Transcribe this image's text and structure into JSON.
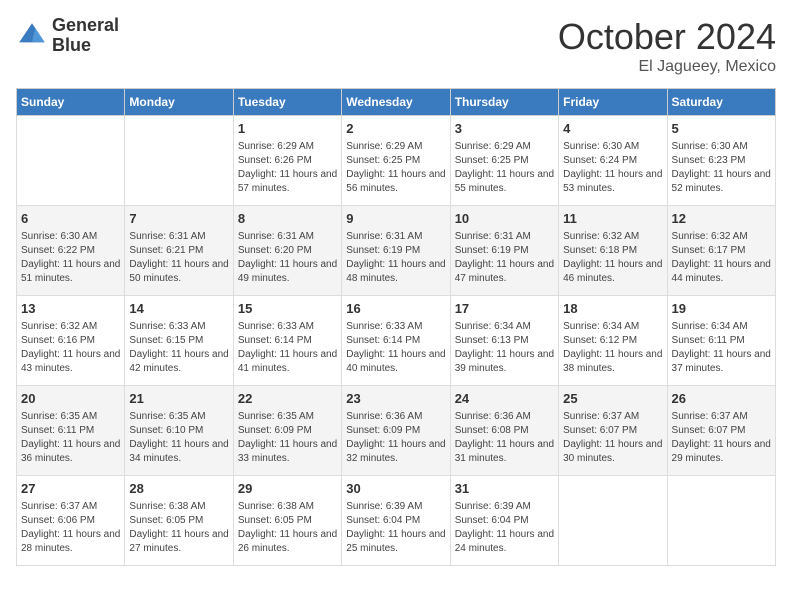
{
  "header": {
    "logo_line1": "General",
    "logo_line2": "Blue",
    "month": "October 2024",
    "location": "El Jagueey, Mexico"
  },
  "columns": [
    "Sunday",
    "Monday",
    "Tuesday",
    "Wednesday",
    "Thursday",
    "Friday",
    "Saturday"
  ],
  "weeks": [
    [
      {
        "day": "",
        "empty": true
      },
      {
        "day": "",
        "empty": true
      },
      {
        "day": "1",
        "sunrise": "Sunrise: 6:29 AM",
        "sunset": "Sunset: 6:26 PM",
        "daylight": "Daylight: 11 hours and 57 minutes."
      },
      {
        "day": "2",
        "sunrise": "Sunrise: 6:29 AM",
        "sunset": "Sunset: 6:25 PM",
        "daylight": "Daylight: 11 hours and 56 minutes."
      },
      {
        "day": "3",
        "sunrise": "Sunrise: 6:29 AM",
        "sunset": "Sunset: 6:25 PM",
        "daylight": "Daylight: 11 hours and 55 minutes."
      },
      {
        "day": "4",
        "sunrise": "Sunrise: 6:30 AM",
        "sunset": "Sunset: 6:24 PM",
        "daylight": "Daylight: 11 hours and 53 minutes."
      },
      {
        "day": "5",
        "sunrise": "Sunrise: 6:30 AM",
        "sunset": "Sunset: 6:23 PM",
        "daylight": "Daylight: 11 hours and 52 minutes."
      }
    ],
    [
      {
        "day": "6",
        "sunrise": "Sunrise: 6:30 AM",
        "sunset": "Sunset: 6:22 PM",
        "daylight": "Daylight: 11 hours and 51 minutes."
      },
      {
        "day": "7",
        "sunrise": "Sunrise: 6:31 AM",
        "sunset": "Sunset: 6:21 PM",
        "daylight": "Daylight: 11 hours and 50 minutes."
      },
      {
        "day": "8",
        "sunrise": "Sunrise: 6:31 AM",
        "sunset": "Sunset: 6:20 PM",
        "daylight": "Daylight: 11 hours and 49 minutes."
      },
      {
        "day": "9",
        "sunrise": "Sunrise: 6:31 AM",
        "sunset": "Sunset: 6:19 PM",
        "daylight": "Daylight: 11 hours and 48 minutes."
      },
      {
        "day": "10",
        "sunrise": "Sunrise: 6:31 AM",
        "sunset": "Sunset: 6:19 PM",
        "daylight": "Daylight: 11 hours and 47 minutes."
      },
      {
        "day": "11",
        "sunrise": "Sunrise: 6:32 AM",
        "sunset": "Sunset: 6:18 PM",
        "daylight": "Daylight: 11 hours and 46 minutes."
      },
      {
        "day": "12",
        "sunrise": "Sunrise: 6:32 AM",
        "sunset": "Sunset: 6:17 PM",
        "daylight": "Daylight: 11 hours and 44 minutes."
      }
    ],
    [
      {
        "day": "13",
        "sunrise": "Sunrise: 6:32 AM",
        "sunset": "Sunset: 6:16 PM",
        "daylight": "Daylight: 11 hours and 43 minutes."
      },
      {
        "day": "14",
        "sunrise": "Sunrise: 6:33 AM",
        "sunset": "Sunset: 6:15 PM",
        "daylight": "Daylight: 11 hours and 42 minutes."
      },
      {
        "day": "15",
        "sunrise": "Sunrise: 6:33 AM",
        "sunset": "Sunset: 6:14 PM",
        "daylight": "Daylight: 11 hours and 41 minutes."
      },
      {
        "day": "16",
        "sunrise": "Sunrise: 6:33 AM",
        "sunset": "Sunset: 6:14 PM",
        "daylight": "Daylight: 11 hours and 40 minutes."
      },
      {
        "day": "17",
        "sunrise": "Sunrise: 6:34 AM",
        "sunset": "Sunset: 6:13 PM",
        "daylight": "Daylight: 11 hours and 39 minutes."
      },
      {
        "day": "18",
        "sunrise": "Sunrise: 6:34 AM",
        "sunset": "Sunset: 6:12 PM",
        "daylight": "Daylight: 11 hours and 38 minutes."
      },
      {
        "day": "19",
        "sunrise": "Sunrise: 6:34 AM",
        "sunset": "Sunset: 6:11 PM",
        "daylight": "Daylight: 11 hours and 37 minutes."
      }
    ],
    [
      {
        "day": "20",
        "sunrise": "Sunrise: 6:35 AM",
        "sunset": "Sunset: 6:11 PM",
        "daylight": "Daylight: 11 hours and 36 minutes."
      },
      {
        "day": "21",
        "sunrise": "Sunrise: 6:35 AM",
        "sunset": "Sunset: 6:10 PM",
        "daylight": "Daylight: 11 hours and 34 minutes."
      },
      {
        "day": "22",
        "sunrise": "Sunrise: 6:35 AM",
        "sunset": "Sunset: 6:09 PM",
        "daylight": "Daylight: 11 hours and 33 minutes."
      },
      {
        "day": "23",
        "sunrise": "Sunrise: 6:36 AM",
        "sunset": "Sunset: 6:09 PM",
        "daylight": "Daylight: 11 hours and 32 minutes."
      },
      {
        "day": "24",
        "sunrise": "Sunrise: 6:36 AM",
        "sunset": "Sunset: 6:08 PM",
        "daylight": "Daylight: 11 hours and 31 minutes."
      },
      {
        "day": "25",
        "sunrise": "Sunrise: 6:37 AM",
        "sunset": "Sunset: 6:07 PM",
        "daylight": "Daylight: 11 hours and 30 minutes."
      },
      {
        "day": "26",
        "sunrise": "Sunrise: 6:37 AM",
        "sunset": "Sunset: 6:07 PM",
        "daylight": "Daylight: 11 hours and 29 minutes."
      }
    ],
    [
      {
        "day": "27",
        "sunrise": "Sunrise: 6:37 AM",
        "sunset": "Sunset: 6:06 PM",
        "daylight": "Daylight: 11 hours and 28 minutes."
      },
      {
        "day": "28",
        "sunrise": "Sunrise: 6:38 AM",
        "sunset": "Sunset: 6:05 PM",
        "daylight": "Daylight: 11 hours and 27 minutes."
      },
      {
        "day": "29",
        "sunrise": "Sunrise: 6:38 AM",
        "sunset": "Sunset: 6:05 PM",
        "daylight": "Daylight: 11 hours and 26 minutes."
      },
      {
        "day": "30",
        "sunrise": "Sunrise: 6:39 AM",
        "sunset": "Sunset: 6:04 PM",
        "daylight": "Daylight: 11 hours and 25 minutes."
      },
      {
        "day": "31",
        "sunrise": "Sunrise: 6:39 AM",
        "sunset": "Sunset: 6:04 PM",
        "daylight": "Daylight: 11 hours and 24 minutes."
      },
      {
        "day": "",
        "empty": true
      },
      {
        "day": "",
        "empty": true
      }
    ]
  ]
}
